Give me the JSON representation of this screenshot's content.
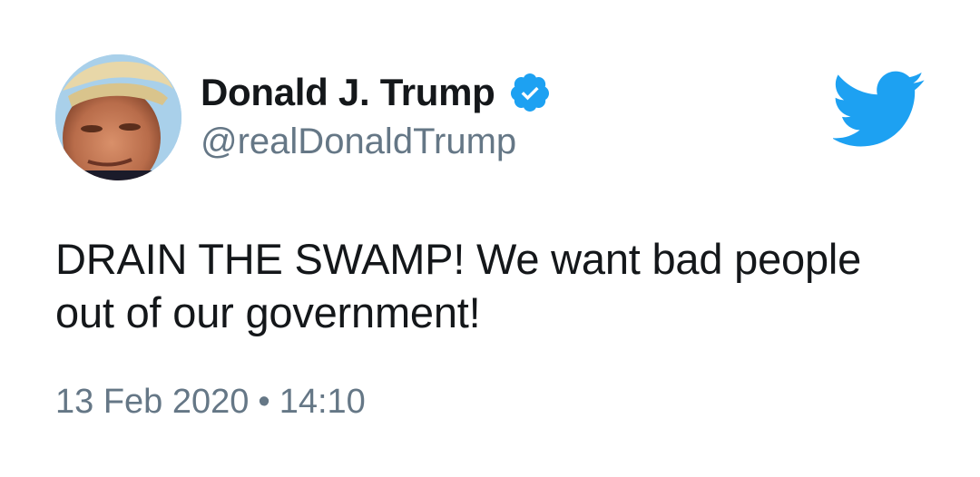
{
  "author": {
    "display_name": "Donald J. Trump",
    "handle": "@realDonaldTrump",
    "verified": true,
    "avatar_icon": "profile-photo",
    "verified_icon": "verified-badge-icon"
  },
  "brand": {
    "logo_icon": "twitter-bird-icon",
    "accent_color": "#1da1f2"
  },
  "tweet": {
    "lines": [
      "DRAIN THE SWAMP! We want bad people",
      "out of our government!"
    ],
    "date": "13 Feb 2020",
    "separator": "•",
    "time": "14:10"
  },
  "colors": {
    "text": "#14171a",
    "secondary_text": "#657786",
    "background": "#ffffff"
  }
}
